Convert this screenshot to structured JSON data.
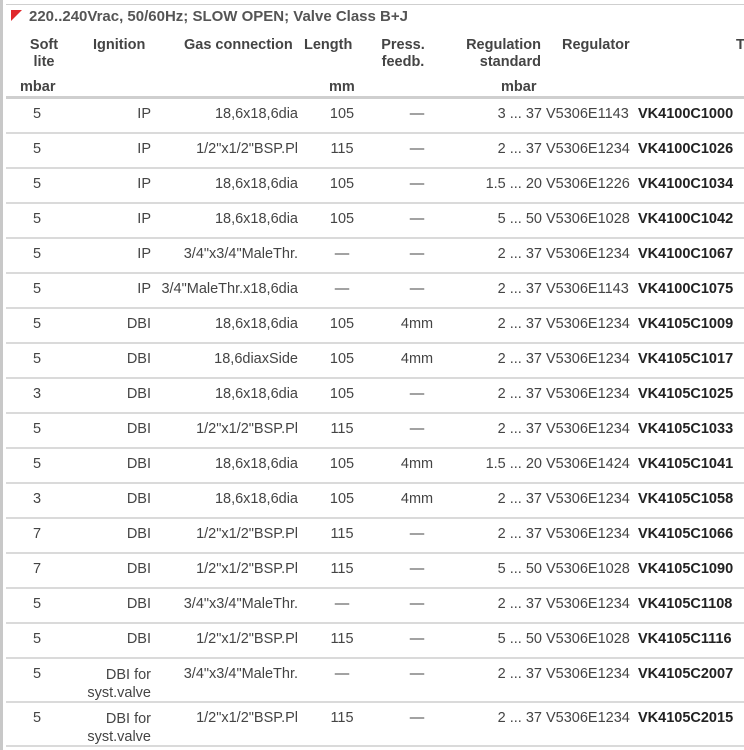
{
  "title": "220..240Vrac, 50/60Hz; SLOW OPEN; Valve Class B+J",
  "headers": {
    "soft_lite": [
      "Soft",
      "lite"
    ],
    "ignition": "Ignition",
    "gas_connection": "Gas connection",
    "length": "Length",
    "press_feedb": [
      "Press.",
      "feedb."
    ],
    "regulation_standard": [
      "Regulation",
      "standard"
    ],
    "regulator": "Regulator",
    "type": "Ty"
  },
  "units": {
    "soft_lite": "mbar",
    "length": "mm",
    "regulation": "mbar"
  },
  "rows": [
    {
      "soft": "5",
      "ign": "IP",
      "gas": "18,6x18,6dia",
      "len": "105",
      "press": "—",
      "reg": "3 ... 37",
      "regulator": "V5306E1143",
      "type": "VK4100C1000"
    },
    {
      "soft": "5",
      "ign": "IP",
      "gas": "1/2\"x1/2\"BSP.Pl",
      "len": "115",
      "press": "—",
      "reg": "2 ... 37",
      "regulator": "V5306E1234",
      "type": "VK4100C1026"
    },
    {
      "soft": "5",
      "ign": "IP",
      "gas": "18,6x18,6dia",
      "len": "105",
      "press": "—",
      "reg": "1.5 ... 20",
      "regulator": "V5306E1226",
      "type": "VK4100C1034"
    },
    {
      "soft": "5",
      "ign": "IP",
      "gas": "18,6x18,6dia",
      "len": "105",
      "press": "—",
      "reg": "5 ... 50",
      "regulator": "V5306E1028",
      "type": "VK4100C1042"
    },
    {
      "soft": "5",
      "ign": "IP",
      "gas": "3/4\"x3/4\"MaleThr.",
      "len": "—",
      "press": "—",
      "reg": "2 ... 37",
      "regulator": "V5306E1234",
      "type": "VK4100C1067"
    },
    {
      "soft": "5",
      "ign": "IP",
      "gas": "3/4\"MaleThr.x18,6dia",
      "len": "—",
      "press": "—",
      "reg": "2 ... 37",
      "regulator": "V5306E1143",
      "type": "VK4100C1075"
    },
    {
      "soft": "5",
      "ign": "DBI",
      "gas": "18,6x18,6dia",
      "len": "105",
      "press": "4mm",
      "reg": "2 ... 37",
      "regulator": "V5306E1234",
      "type": "VK4105C1009"
    },
    {
      "soft": "5",
      "ign": "DBI",
      "gas": "18,6diaxSide",
      "len": "105",
      "press": "4mm",
      "reg": "2 ... 37",
      "regulator": "V5306E1234",
      "type": "VK4105C1017"
    },
    {
      "soft": "3",
      "ign": "DBI",
      "gas": "18,6x18,6dia",
      "len": "105",
      "press": "—",
      "reg": "2 ... 37",
      "regulator": "V5306E1234",
      "type": "VK4105C1025"
    },
    {
      "soft": "5",
      "ign": "DBI",
      "gas": "1/2\"x1/2\"BSP.Pl",
      "len": "115",
      "press": "—",
      "reg": "2 ... 37",
      "regulator": "V5306E1234",
      "type": "VK4105C1033"
    },
    {
      "soft": "5",
      "ign": "DBI",
      "gas": "18,6x18,6dia",
      "len": "105",
      "press": "4mm",
      "reg": "1.5 ... 20",
      "regulator": "V5306E1424",
      "type": "VK4105C1041"
    },
    {
      "soft": "3",
      "ign": "DBI",
      "gas": "18,6x18,6dia",
      "len": "105",
      "press": "4mm",
      "reg": "2 ... 37",
      "regulator": "V5306E1234",
      "type": "VK4105C1058"
    },
    {
      "soft": "7",
      "ign": "DBI",
      "gas": "1/2\"x1/2\"BSP.Pl",
      "len": "115",
      "press": "—",
      "reg": "2 ... 37",
      "regulator": "V5306E1234",
      "type": "VK4105C1066"
    },
    {
      "soft": "7",
      "ign": "DBI",
      "gas": "1/2\"x1/2\"BSP.Pl",
      "len": "115",
      "press": "—",
      "reg": "5 ... 50",
      "regulator": "V5306E1028",
      "type": "VK4105C1090"
    },
    {
      "soft": "5",
      "ign": "DBI",
      "gas": "3/4\"x3/4\"MaleThr.",
      "len": "—",
      "press": "—",
      "reg": "2 ... 37",
      "regulator": "V5306E1234",
      "type": "VK4105C1108"
    },
    {
      "soft": "5",
      "ign": "DBI",
      "gas": "1/2\"x1/2\"BSP.Pl",
      "len": "115",
      "press": "—",
      "reg": "5 ... 50",
      "regulator": "V5306E1028",
      "type": "VK4105C1116"
    },
    {
      "soft": "5",
      "ign": [
        "DBI for",
        "syst.valve"
      ],
      "gas": "3/4\"x3/4\"MaleThr.",
      "len": "—",
      "press": "—",
      "reg": "2 ... 37",
      "regulator": "V5306E1234",
      "type": "VK4105C2007"
    },
    {
      "soft": "5",
      "ign": [
        "DBI for",
        "syst.valve"
      ],
      "gas": "1/2\"x1/2\"BSP.Pl",
      "len": "115",
      "press": "—",
      "reg": "2 ... 37",
      "regulator": "V5306E1234",
      "type": "VK4105C2015"
    }
  ]
}
